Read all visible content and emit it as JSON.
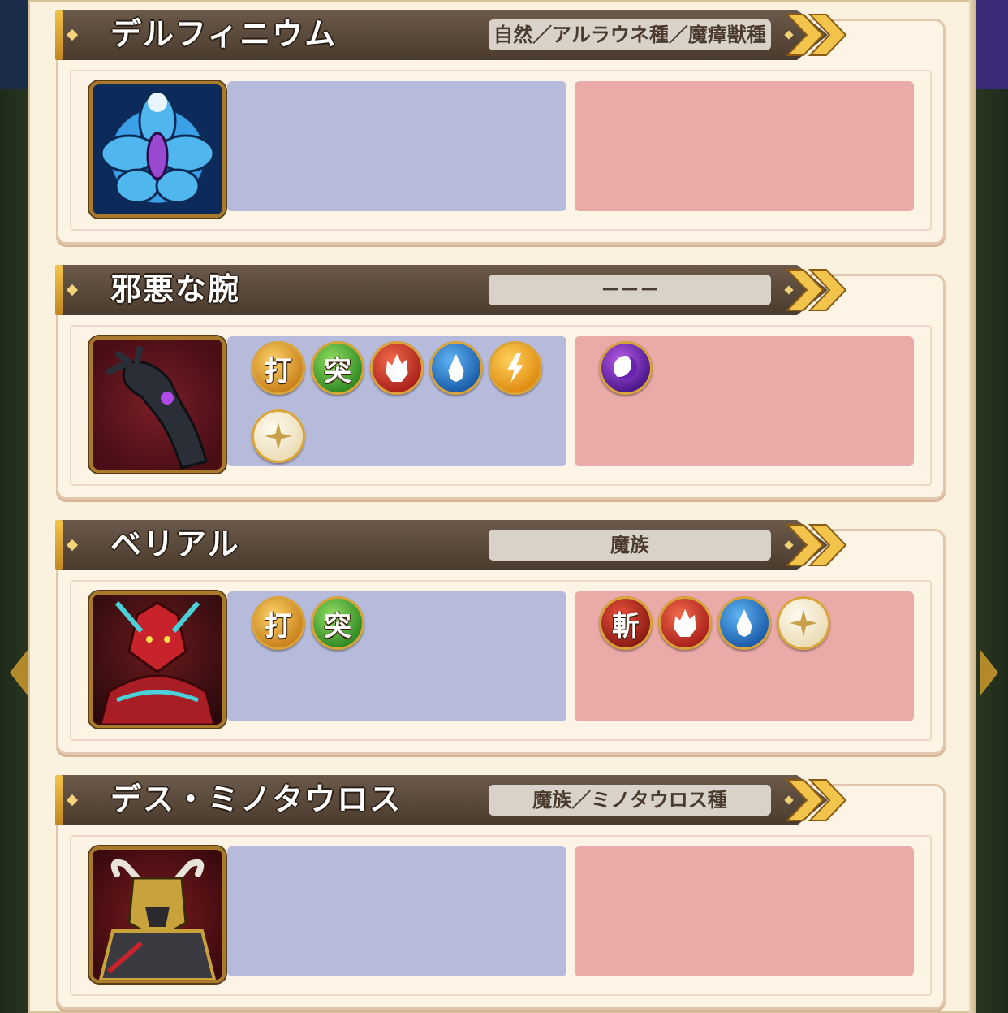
{
  "monsters": [
    {
      "name": "デルフィニウム",
      "type": "自然／アルラウネ種／魔瘴獣種",
      "portrait": "delphinium-portrait",
      "weak": [],
      "resist": []
    },
    {
      "name": "邪悪な腕",
      "type": "－－－",
      "portrait": "evil-arm-portrait",
      "weak": [
        {
          "kind": "blunt",
          "label": "打"
        },
        {
          "kind": "pierce",
          "label": "突"
        },
        {
          "kind": "fire",
          "label": ""
        },
        {
          "kind": "water",
          "label": ""
        },
        {
          "kind": "thunder",
          "label": ""
        },
        {
          "kind": "light",
          "label": ""
        }
      ],
      "resist": [
        {
          "kind": "dark",
          "label": ""
        }
      ]
    },
    {
      "name": "ベリアル",
      "type": "魔族",
      "portrait": "belial-portrait",
      "weak": [
        {
          "kind": "blunt",
          "label": "打"
        },
        {
          "kind": "pierce",
          "label": "突"
        }
      ],
      "resist": [
        {
          "kind": "slash",
          "label": "斬"
        },
        {
          "kind": "fire",
          "label": ""
        },
        {
          "kind": "water",
          "label": ""
        },
        {
          "kind": "light",
          "label": ""
        }
      ]
    },
    {
      "name": "デス・ミノタウロス",
      "type": "魔族／ミノタウロス種",
      "portrait": "death-minotaur-portrait",
      "weak": [],
      "resist": []
    }
  ],
  "colors": {
    "weak_box": "#b7bbdb",
    "resist_box": "#e9aaa8",
    "header": "#4a3b2e",
    "accent_gold": "#f2c44b"
  }
}
